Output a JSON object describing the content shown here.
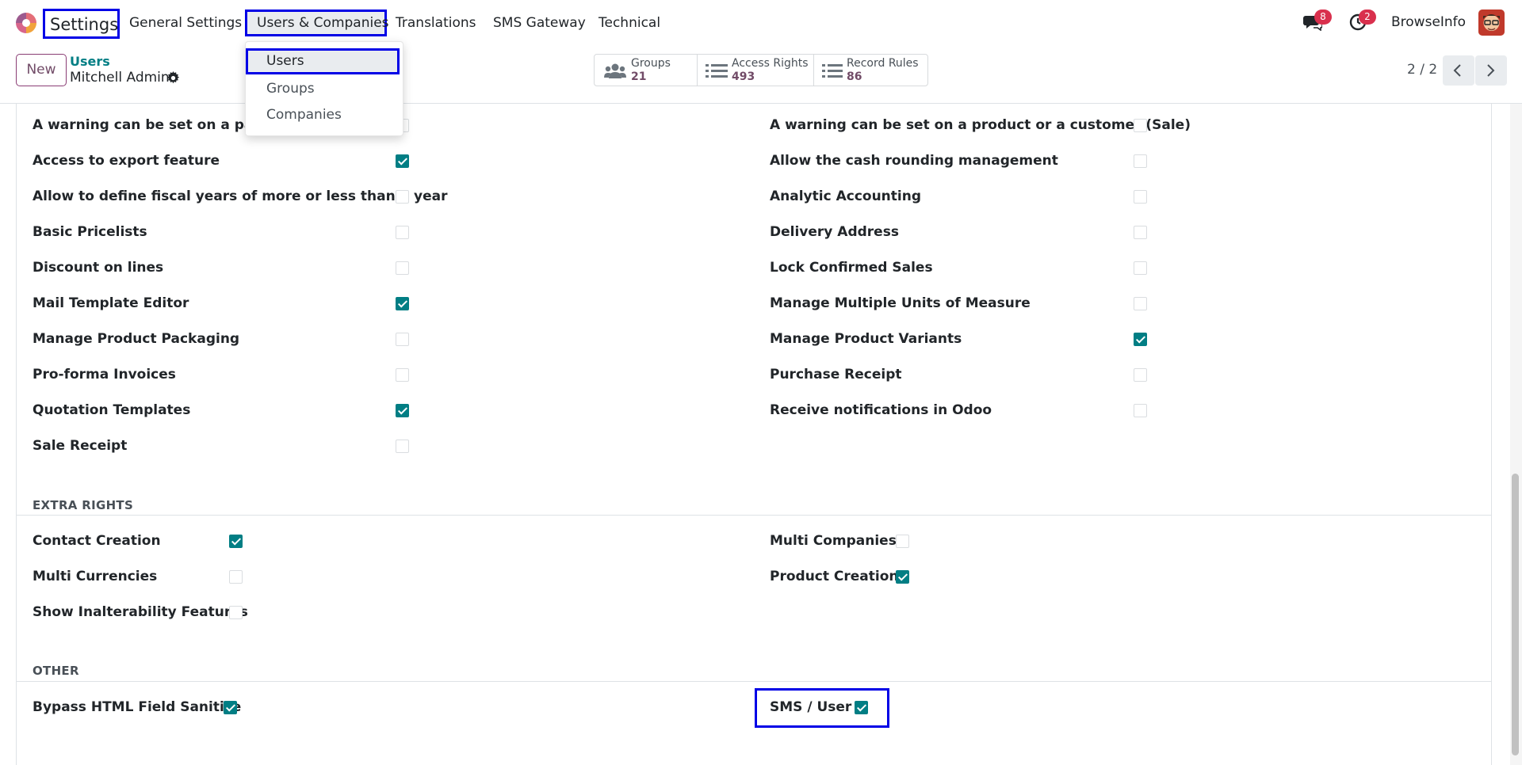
{
  "navbar": {
    "brand": "Settings",
    "menus": [
      {
        "label": "General Settings"
      },
      {
        "label": "Users & Companies"
      },
      {
        "label": "Translations"
      },
      {
        "label": "SMS Gateway"
      },
      {
        "label": "Technical"
      }
    ],
    "messages_count": "8",
    "activities_count": "2",
    "company": "BrowseInfo"
  },
  "dropdown": {
    "items": [
      {
        "label": "Users"
      },
      {
        "label": "Groups"
      },
      {
        "label": "Companies"
      }
    ]
  },
  "control_panel": {
    "new_label": "New",
    "breadcrumb": "Users",
    "record_name": "Mitchell Admin",
    "smart_buttons": [
      {
        "label": "Groups",
        "value": "21"
      },
      {
        "label": "Access Rights",
        "value": "493"
      },
      {
        "label": "Record Rules",
        "value": "86"
      }
    ],
    "pager": "2 / 2"
  },
  "technical_rights": {
    "left": [
      {
        "label": "A warning can be set on a partner",
        "checked": false
      },
      {
        "label": "Access to export feature",
        "checked": true
      },
      {
        "label": "Allow to define fiscal years of more or less than a year",
        "checked": false
      },
      {
        "label": "Basic Pricelists",
        "checked": false
      },
      {
        "label": "Discount on lines",
        "checked": false
      },
      {
        "label": "Mail Template Editor",
        "checked": true
      },
      {
        "label": "Manage Product Packaging",
        "checked": false
      },
      {
        "label": "Pro-forma Invoices",
        "checked": false
      },
      {
        "label": "Quotation Templates",
        "checked": true
      },
      {
        "label": "Sale Receipt",
        "checked": false
      }
    ],
    "right": [
      {
        "label": "A warning can be set on a product or a customer (Sale)",
        "checked": false
      },
      {
        "label": "Allow the cash rounding management",
        "checked": false
      },
      {
        "label": "Analytic Accounting",
        "checked": false
      },
      {
        "label": "Delivery Address",
        "checked": false
      },
      {
        "label": "Lock Confirmed Sales",
        "checked": false
      },
      {
        "label": "Manage Multiple Units of Measure",
        "checked": false
      },
      {
        "label": "Manage Product Variants",
        "checked": true
      },
      {
        "label": "Purchase Receipt",
        "checked": false
      },
      {
        "label": "Receive notifications in Odoo",
        "checked": false
      }
    ]
  },
  "extra_rights": {
    "title": "EXTRA RIGHTS",
    "left": [
      {
        "label": "Contact Creation",
        "checked": true
      },
      {
        "label": "Multi Currencies",
        "checked": false
      },
      {
        "label": "Show Inalterability Features",
        "checked": false
      }
    ],
    "right": [
      {
        "label": "Multi Companies",
        "checked": false
      },
      {
        "label": "Product Creation",
        "checked": true
      }
    ]
  },
  "other": {
    "title": "OTHER",
    "left": [
      {
        "label": "Bypass HTML Field Sanitize",
        "checked": true
      }
    ],
    "right": [
      {
        "label": "SMS / User",
        "checked": true
      }
    ]
  },
  "colors": {
    "accent": "#017e84",
    "brand": "#714b67",
    "highlight": "#0000e6",
    "badge": "#d9304d"
  }
}
